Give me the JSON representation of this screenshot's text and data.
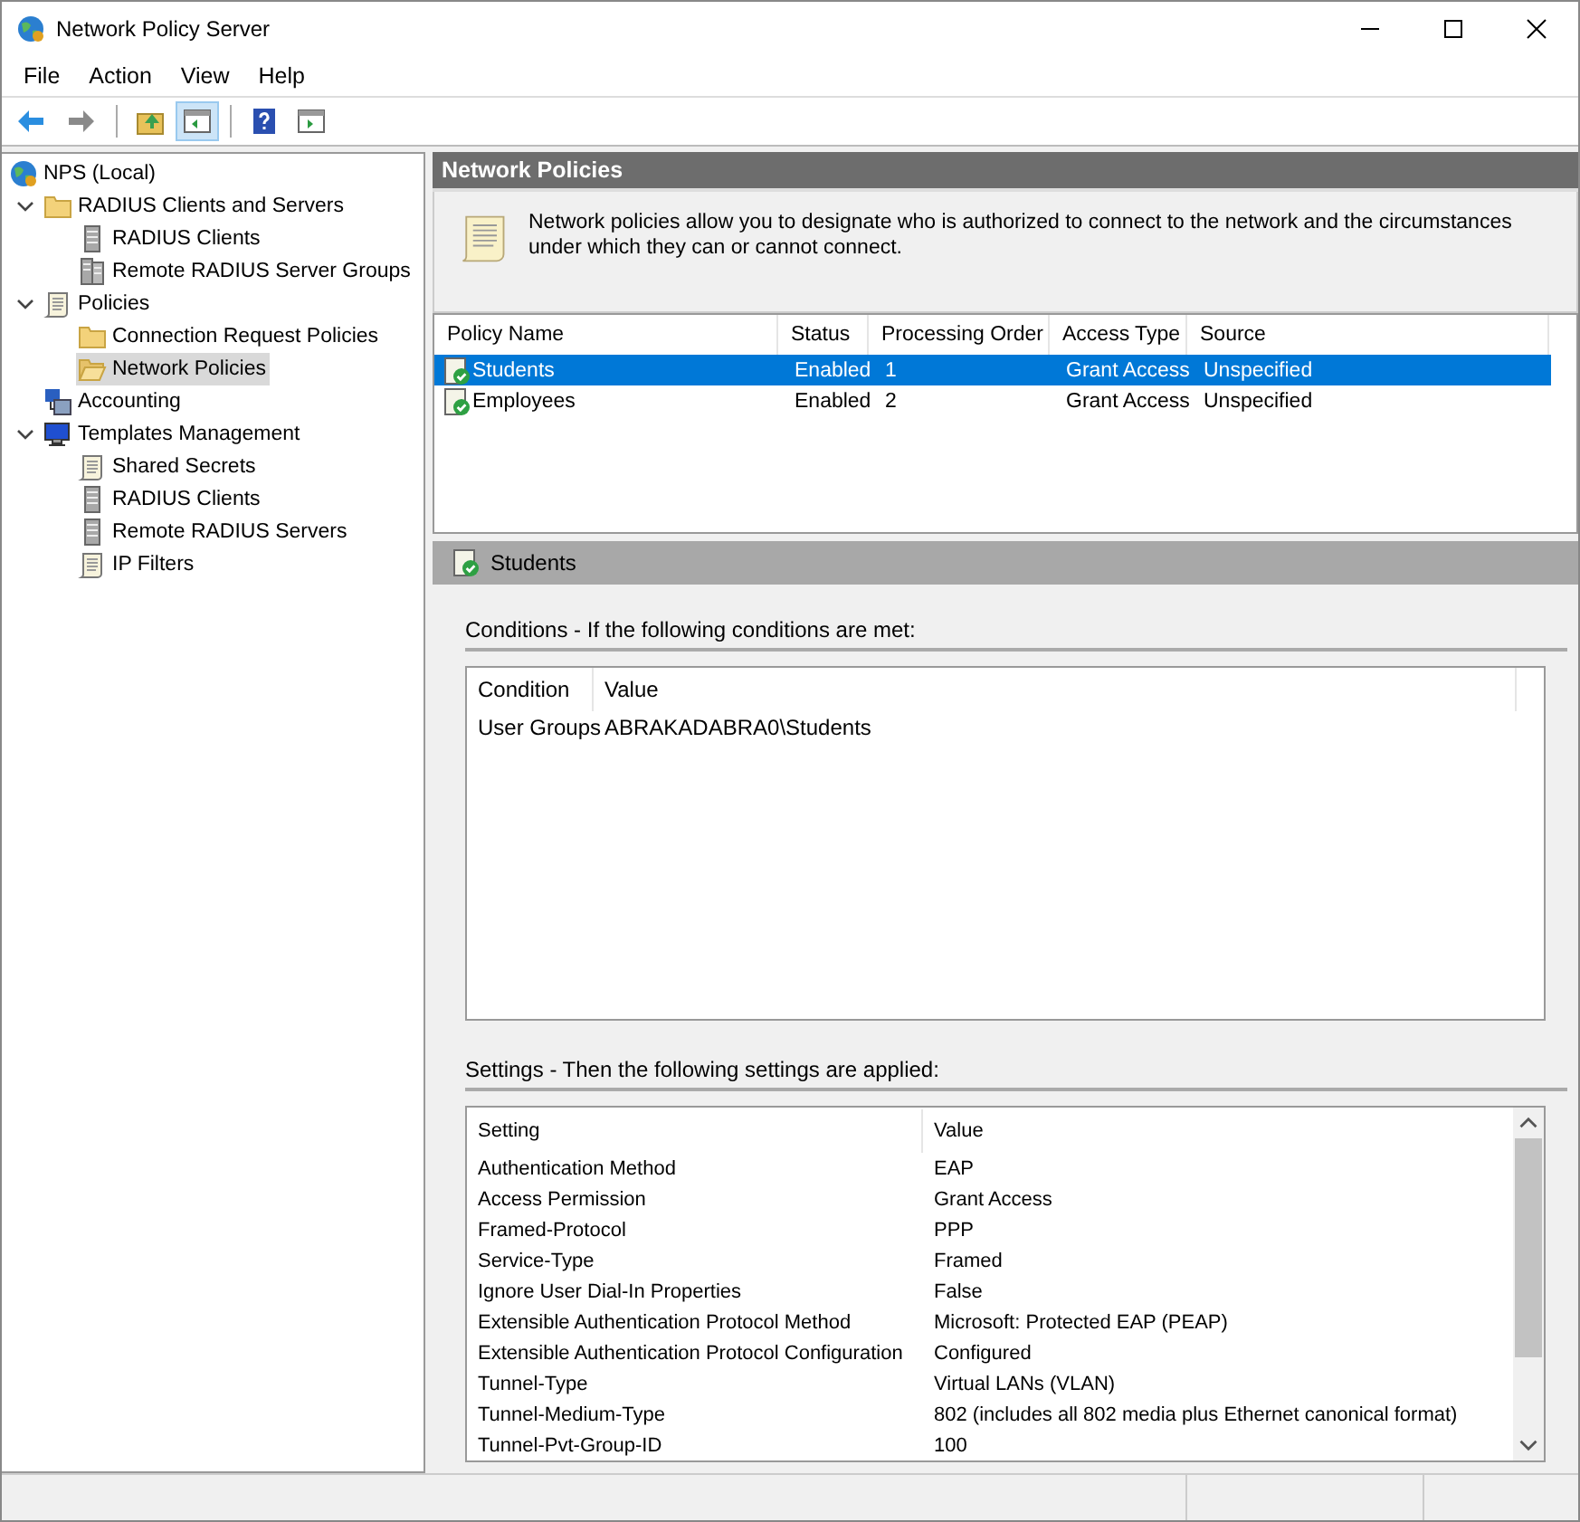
{
  "window": {
    "title": "Network Policy Server"
  },
  "menu": [
    "File",
    "Action",
    "View",
    "Help"
  ],
  "toolbar": [
    {
      "kind": "back",
      "selected": false
    },
    {
      "kind": "forward",
      "selected": false
    },
    {
      "kind": "up",
      "selected": false
    },
    {
      "kind": "tree",
      "selected": true
    },
    {
      "kind": "help",
      "selected": false
    },
    {
      "kind": "action-pane",
      "selected": false
    }
  ],
  "tree": [
    {
      "label": "NPS (Local)",
      "kind": "globe",
      "selected": false,
      "children": [
        {
          "label": "RADIUS Clients and Servers",
          "kind": "folder",
          "selected": false,
          "expanded": true,
          "children": [
            {
              "label": "RADIUS Clients",
              "kind": "server",
              "selected": false
            },
            {
              "label": "Remote RADIUS Server Groups",
              "kind": "servers",
              "selected": false
            }
          ]
        },
        {
          "label": "Policies",
          "kind": "scroll",
          "selected": false,
          "expanded": true,
          "children": [
            {
              "label": "Connection Request Policies",
              "kind": "folder",
              "selected": false
            },
            {
              "label": "Network Policies",
              "kind": "folder-open",
              "selected": true
            }
          ]
        },
        {
          "label": "Accounting",
          "kind": "network",
          "selected": false
        },
        {
          "label": "Templates Management",
          "kind": "monitor",
          "selected": false,
          "expanded": true,
          "children": [
            {
              "label": "Shared Secrets",
              "kind": "scroll",
              "selected": false
            },
            {
              "label": "RADIUS Clients",
              "kind": "server",
              "selected": false
            },
            {
              "label": "Remote RADIUS Servers",
              "kind": "server",
              "selected": false
            },
            {
              "label": "IP Filters",
              "kind": "scroll",
              "selected": false
            }
          ]
        }
      ]
    }
  ],
  "header": {
    "title": "Network Policies"
  },
  "description": "Network policies allow you to designate who is authorized to connect to the network and the circumstances under which they can or cannot connect.",
  "policies": {
    "columns": [
      "Policy Name",
      "Status",
      "Processing Order",
      "Access Type",
      "Source"
    ],
    "rows": [
      {
        "selected": true,
        "cells": [
          "Students",
          "Enabled",
          "1",
          "Grant Access",
          "Unspecified"
        ]
      },
      {
        "selected": false,
        "cells": [
          "Employees",
          "Enabled",
          "2",
          "Grant Access",
          "Unspecified"
        ]
      }
    ]
  },
  "details": {
    "title": "Students",
    "conditions": {
      "title": "Conditions - If the following conditions are met:",
      "columns": [
        "Condition",
        "Value"
      ],
      "rows": [
        [
          "User Groups",
          "ABRAKADABRA0\\Students"
        ]
      ]
    },
    "settings": {
      "title": "Settings - Then the following settings are applied:",
      "columns": [
        "Setting",
        "Value"
      ],
      "rows": [
        [
          "Authentication Method",
          "EAP"
        ],
        [
          "Access Permission",
          "Grant Access"
        ],
        [
          "Framed-Protocol",
          "PPP"
        ],
        [
          "Service-Type",
          "Framed"
        ],
        [
          "Ignore User Dial-In Properties",
          "False"
        ],
        [
          "Extensible Authentication Protocol Method",
          "Microsoft: Protected EAP (PEAP)"
        ],
        [
          "Extensible Authentication Protocol Configuration",
          "Configured"
        ],
        [
          "Tunnel-Type",
          "Virtual LANs (VLAN)"
        ],
        [
          "Tunnel-Medium-Type",
          "802 (includes all 802 media plus Ethernet canonical format)"
        ],
        [
          "Tunnel-Pvt-Group-ID",
          "100"
        ]
      ]
    }
  }
}
